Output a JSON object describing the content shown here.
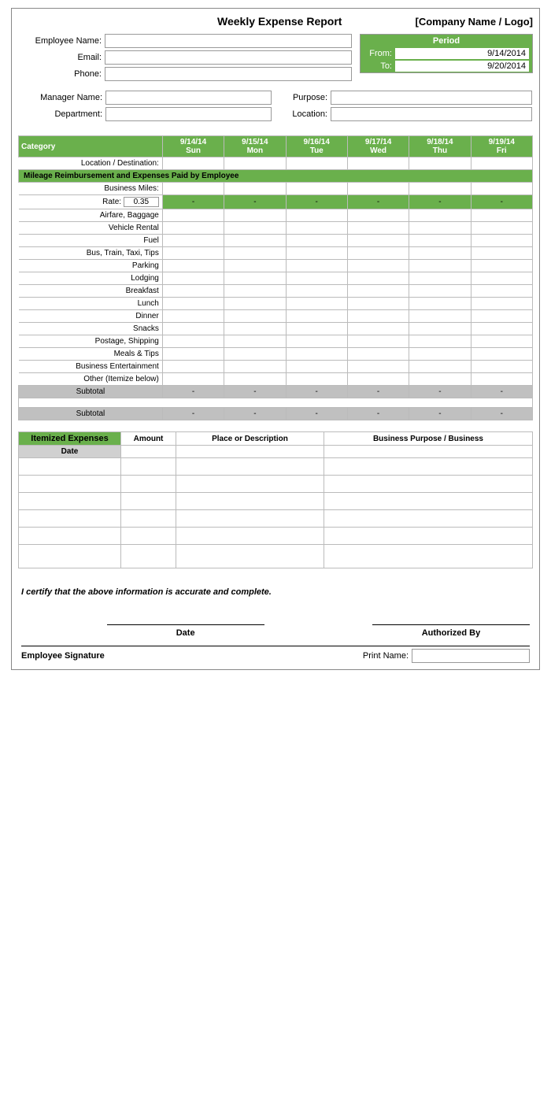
{
  "header": {
    "title": "Weekly Expense Report",
    "company": "[Company Name / Logo]"
  },
  "employee": {
    "name_label": "Employee Name:",
    "email_label": "Email:",
    "phone_label": "Phone:"
  },
  "period": {
    "label": "Period",
    "from_label": "From:",
    "from_value": "9/14/2014",
    "to_label": "To:",
    "to_value": "9/20/2014"
  },
  "manager": {
    "name_label": "Manager Name:",
    "department_label": "Department:"
  },
  "purpose": {
    "purpose_label": "Purpose:",
    "location_label": "Location:"
  },
  "table": {
    "category_label": "Category",
    "dates": [
      "9/14/14",
      "9/15/14",
      "9/16/14",
      "9/17/14",
      "9/18/14",
      "9/19/14"
    ],
    "days": [
      "Sun",
      "Mon",
      "Tue",
      "Wed",
      "Thu",
      "Fri"
    ],
    "location_destination": "Location / Destination:",
    "mileage_section": "Mileage Reimbursement and Expenses Paid by Employee",
    "business_miles_label": "Business Miles:",
    "rate_label": "Rate:",
    "rate_value": "0.35",
    "dash": "-",
    "categories": [
      "Airfare, Baggage",
      "Vehicle Rental",
      "Fuel",
      "Bus, Train, Taxi, Tips",
      "Parking",
      "Lodging",
      "Breakfast",
      "Lunch",
      "Dinner",
      "Snacks",
      "Postage, Shipping",
      "Meals & Tips",
      "Business Entertainment",
      "Other (Itemize below)"
    ],
    "subtotal_label": "Subtotal"
  },
  "itemized": {
    "header": "Itemized Expenses",
    "amount": "Amount",
    "place": "Place or Description",
    "business_purpose": "Business Purpose / Business",
    "date_label": "Date"
  },
  "signature": {
    "certify": "I certify that the above information is accurate and complete.",
    "date_label": "Date",
    "authorized_label": "Authorized By",
    "employee_sig": "Employee Signature",
    "print_name": "Print Name:"
  }
}
